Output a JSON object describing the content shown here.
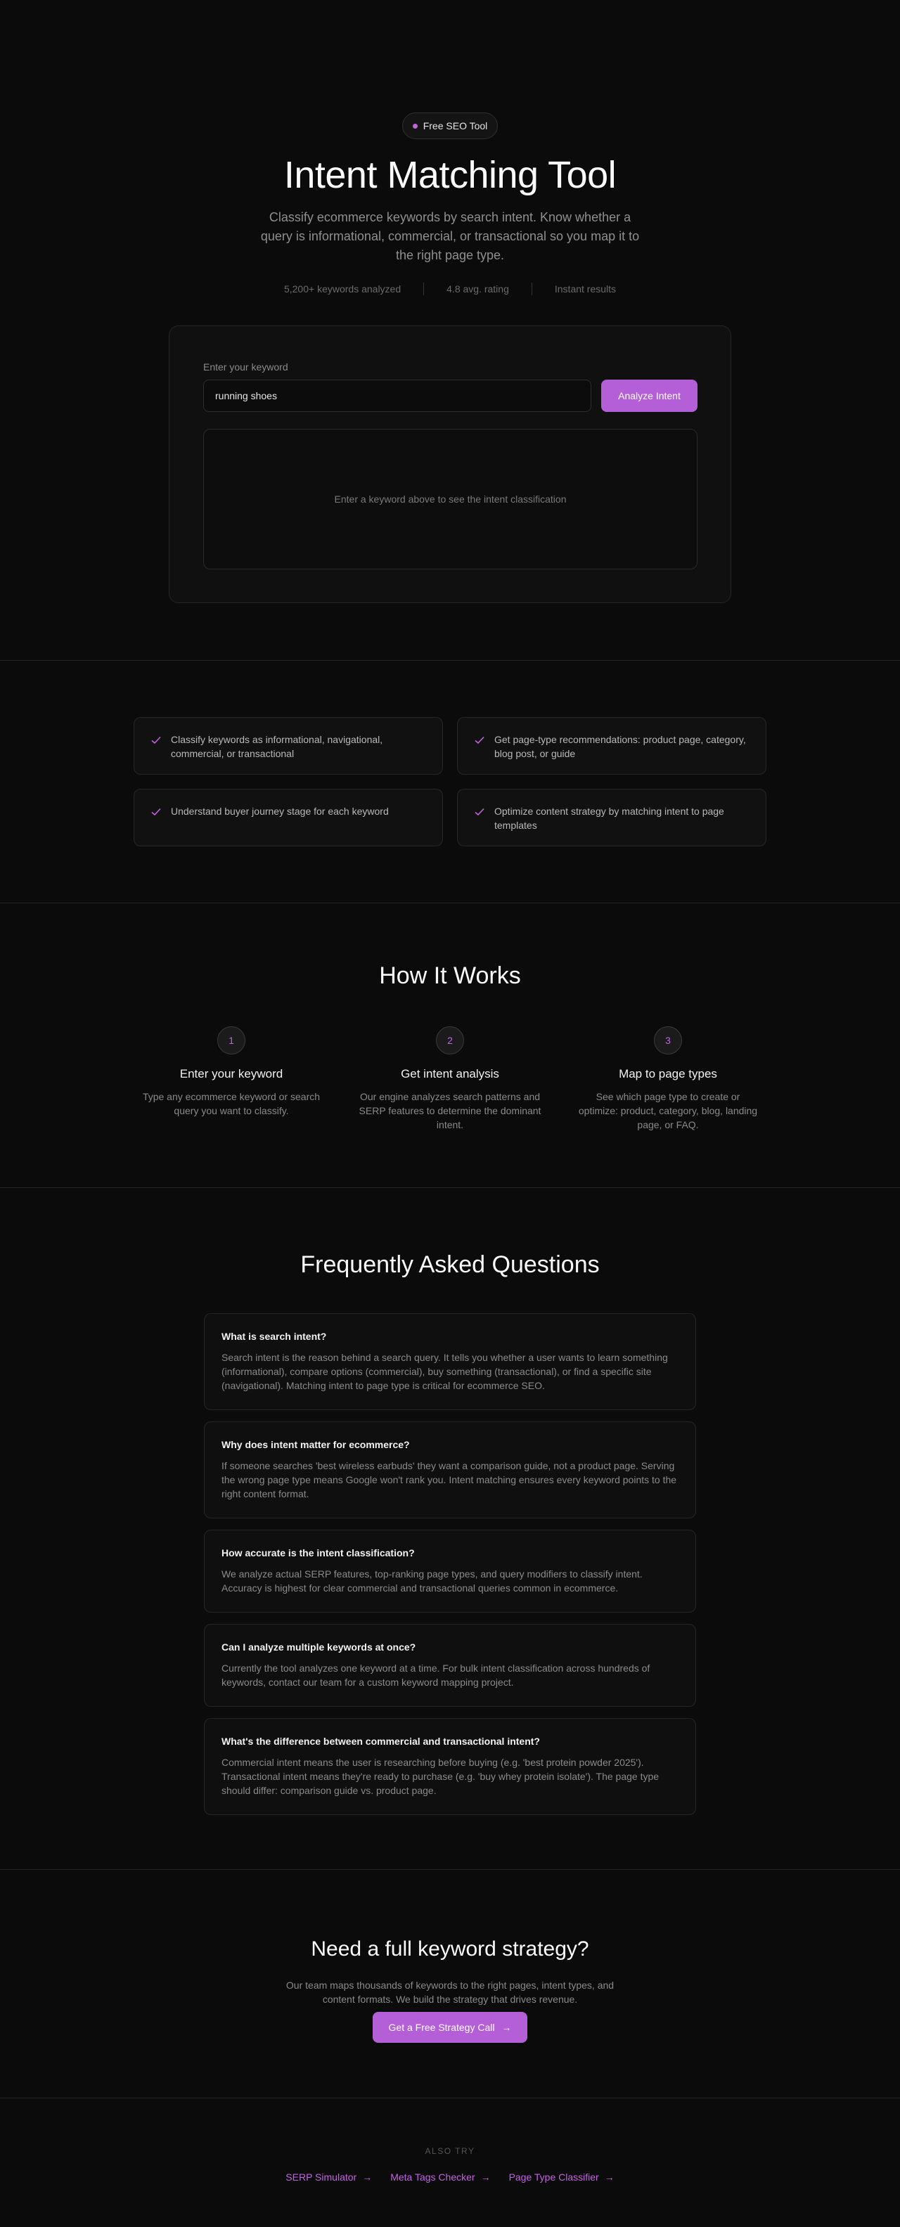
{
  "hero": {
    "badge": "Free SEO Tool",
    "title": "Intent Matching Tool",
    "subtitle": "Classify ecommerce keywords by search intent. Know whether a query is informational, commercial, or transactional so you map it to the right page type.",
    "stats": [
      "5,200+ keywords analyzed",
      "4.8 avg. rating",
      "Instant results"
    ]
  },
  "tool": {
    "label": "Enter your keyword",
    "input_value": "running shoes",
    "button": "Analyze Intent",
    "result_placeholder": "Enter a keyword above to see the intent classification"
  },
  "features": [
    "Classify keywords as informational, navigational, commercial, or transactional",
    "Get page-type recommendations: product page, category, blog post, or guide",
    "Understand buyer journey stage for each keyword",
    "Optimize content strategy by matching intent to page templates"
  ],
  "how": {
    "title": "How It Works",
    "steps": [
      {
        "num": "1",
        "title": "Enter your keyword",
        "text": "Type any ecommerce keyword or search query you want to classify."
      },
      {
        "num": "2",
        "title": "Get intent analysis",
        "text": "Our engine analyzes search patterns and SERP features to determine the dominant intent."
      },
      {
        "num": "3",
        "title": "Map to page types",
        "text": "See which page type to create or optimize: product, category, blog, landing page, or FAQ."
      }
    ]
  },
  "faq": {
    "title": "Frequently Asked Questions",
    "items": [
      {
        "q": "What is search intent?",
        "a": "Search intent is the reason behind a search query. It tells you whether a user wants to learn something (informational), compare options (commercial), buy something (transactional), or find a specific site (navigational). Matching intent to page type is critical for ecommerce SEO."
      },
      {
        "q": "Why does intent matter for ecommerce?",
        "a": "If someone searches 'best wireless earbuds' they want a comparison guide, not a product page. Serving the wrong page type means Google won't rank you. Intent matching ensures every keyword points to the right content format."
      },
      {
        "q": "How accurate is the intent classification?",
        "a": "We analyze actual SERP features, top-ranking page types, and query modifiers to classify intent. Accuracy is highest for clear commercial and transactional queries common in ecommerce."
      },
      {
        "q": "Can I analyze multiple keywords at once?",
        "a": "Currently the tool analyzes one keyword at a time. For bulk intent classification across hundreds of keywords, contact our team for a custom keyword mapping project."
      },
      {
        "q": "What's the difference between commercial and transactional intent?",
        "a": "Commercial intent means the user is researching before buying (e.g. 'best protein powder 2025'). Transactional intent means they're ready to purchase (e.g. 'buy whey protein isolate'). The page type should differ: comparison guide vs. product page."
      }
    ]
  },
  "cta": {
    "title": "Need a full keyword strategy?",
    "text": "Our team maps thousands of keywords to the right pages, intent types, and content formats. We build the strategy that drives revenue.",
    "button": "Get a Free Strategy Call"
  },
  "footer": {
    "also_try": "ALSO TRY",
    "links": [
      "SERP Simulator",
      "Meta Tags Checker",
      "Page Type Classifier"
    ]
  }
}
